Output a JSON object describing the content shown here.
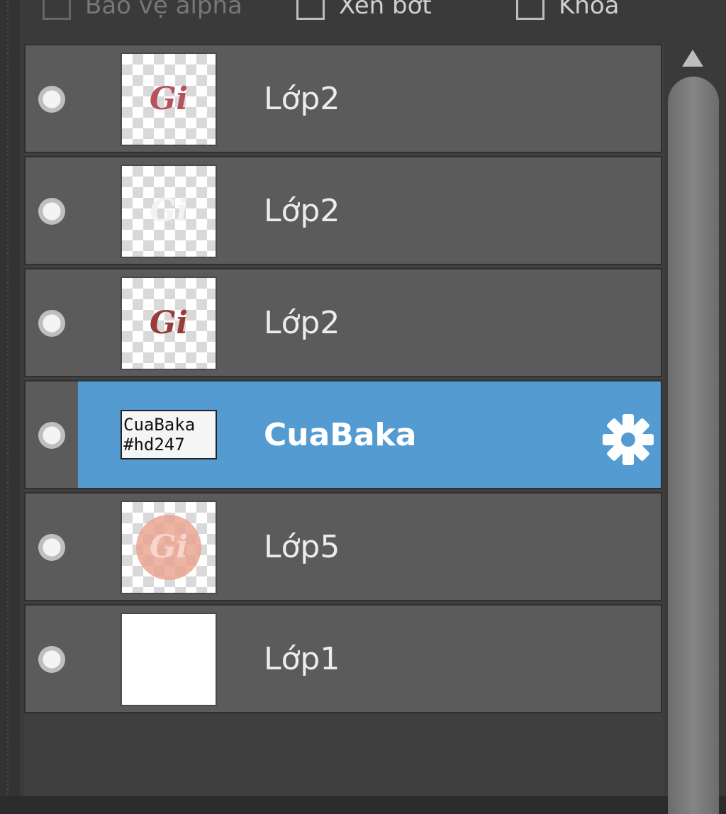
{
  "options": {
    "alpha_label": "Bảo vệ alpha",
    "clip_label": "Xén bớt",
    "lock_label": "Khóa"
  },
  "layers": [
    {
      "name": "Lớp2",
      "thumb_text": "Gi",
      "thumb_color": "#b5525a",
      "visible": true
    },
    {
      "name": "Lớp2",
      "thumb_text": "Gi",
      "thumb_color": "#f2f2f2",
      "visible": true
    },
    {
      "name": "Lớp2",
      "thumb_text": "Gi",
      "thumb_color": "#9a3b3b",
      "visible": true
    },
    {
      "name": "CuaBaka",
      "thumb_lines": [
        "CuaBaka",
        "#hd247"
      ],
      "selected": true,
      "visible": true
    },
    {
      "name": "Lớp5",
      "thumb_text": "Gi",
      "thumb_color": "#f6d6cc",
      "visible": true
    },
    {
      "name": "Lớp1",
      "visible": true
    }
  ],
  "colors": {
    "selection": "#539bd0",
    "row": "#5b5b5b",
    "panel": "#3a3a3a"
  }
}
